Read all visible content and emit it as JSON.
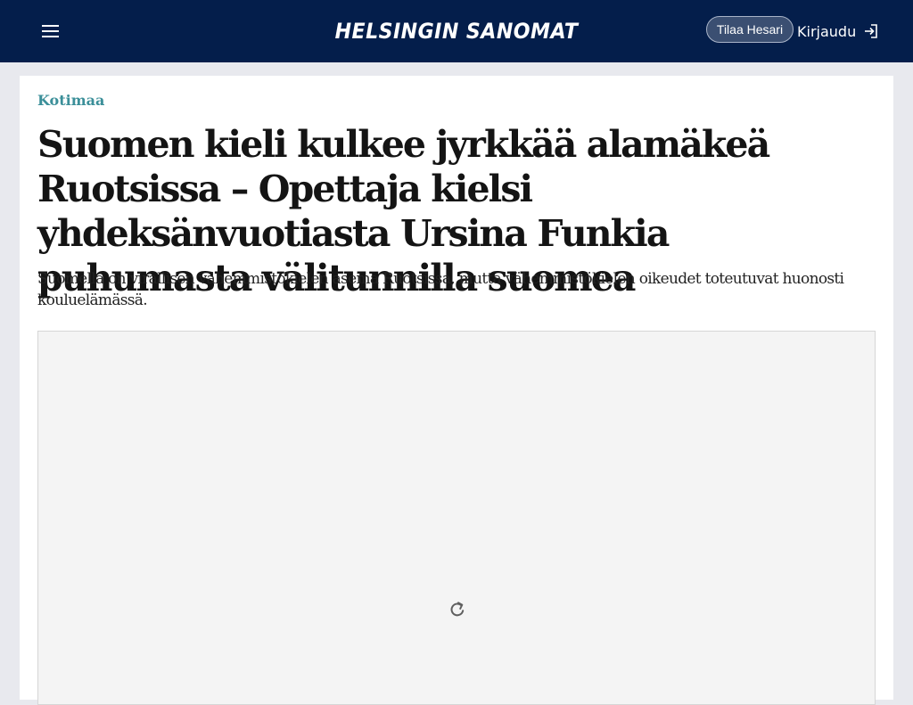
{
  "header": {
    "brand": "HELSINGIN SANOMAT",
    "menu_icon": "hamburger-menu-icon",
    "subscribe_label": "Tilaa Hesari",
    "login_label": "Kirjaudu",
    "login_icon": "login-arrow-icon",
    "background_color": "#041e4b"
  },
  "article": {
    "section": "Kotimaa",
    "headline": "Suomen kieli kulkee jyrkkää alamäkeä Ruotsissa – Opettaja kielsi yhdeksänvuotiasta Ursina Funkia puhumasta välitunnilla suomea",
    "lead": "Suomella on virallisen vähemmistökielen asema Ruotsissa, mutta vähemmistökielen oikeudet toteutuvat huonosti koulu­elämässä.",
    "section_color": "#3b8f99",
    "media_loading_icon": "reload-icon"
  }
}
